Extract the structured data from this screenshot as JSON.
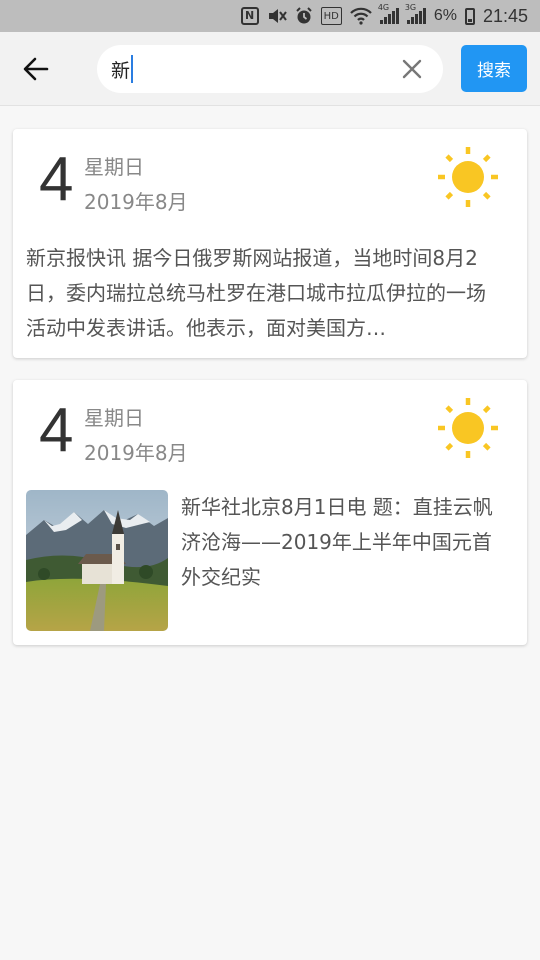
{
  "status_bar": {
    "battery": "6%",
    "time": "21:45",
    "net1": "4G",
    "net2": "3G",
    "hd": "HD",
    "nfc": "N",
    "icons": [
      "nfc-icon",
      "mute-icon",
      "alarm-icon",
      "hd-icon",
      "wifi-icon",
      "signal-icon",
      "signal-icon",
      "battery-icon"
    ]
  },
  "header": {
    "search_value": "新",
    "search_button": "搜索",
    "back_icon": "arrow-left-icon",
    "clear_icon": "close-icon"
  },
  "cards": [
    {
      "day": "4",
      "weekday": "星期日",
      "year_month": "2019年8月",
      "weather_icon": "sun-icon",
      "summary": "新京报快讯 据今日俄罗斯网站报道，当地时间8月2日，委内瑞拉总统马杜罗在港口城市拉瓜伊拉的一场活动中发表讲话。他表示，面对美国方…"
    },
    {
      "day": "4",
      "weekday": "星期日",
      "year_month": "2019年8月",
      "weather_icon": "sun-icon",
      "headline": "新华社北京8月1日电 题：直挂云帆济沧海——2019年上半年中国元首外交纪实",
      "thumbnail": "mountain-church-photo"
    }
  ],
  "colors": {
    "accent": "#2196f3",
    "sun": "#f9c623",
    "caret": "#2a7de1"
  }
}
